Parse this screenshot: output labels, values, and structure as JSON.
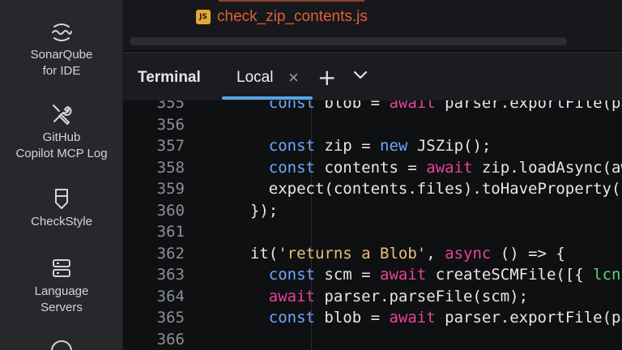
{
  "sidebar": {
    "items": [
      {
        "label": "SonarQube for IDE",
        "line1": "SonarQube",
        "line2": "for IDE",
        "icon": "sonar-wave-icon"
      },
      {
        "label": "GitHub Copilot MCP Log",
        "line1": "GitHub",
        "line2": "Copilot MCP Log",
        "icon": "wrench-screwdriver-icon"
      },
      {
        "label": "CheckStyle",
        "line1": "CheckStyle",
        "line2": "",
        "icon": "checkstyle-shield-icon"
      },
      {
        "label": "Language Servers",
        "line1": "Language",
        "line2": "Servers",
        "icon": "server-stack-icon"
      }
    ]
  },
  "files": {
    "current_file": "check_zip_contents.js",
    "badge": "JS"
  },
  "terminal": {
    "title": "Terminal",
    "tab_label": "Local",
    "close_glyph": "×",
    "add_glyph": "+"
  },
  "code": {
    "lines": [
      {
        "n": "355",
        "text": "    const blob = await parser.exportFile(par"
      },
      {
        "n": "356",
        "text": ""
      },
      {
        "n": "357",
        "text": "    const zip = new JSZip();"
      },
      {
        "n": "358",
        "text": "    const contents = await zip.loadAsync(awa"
      },
      {
        "n": "359",
        "text": "    expect(contents.files).toHaveProperty('C"
      },
      {
        "n": "360",
        "text": "  });"
      },
      {
        "n": "361",
        "text": ""
      },
      {
        "n": "362",
        "text": "  it('returns a Blob', async () => {"
      },
      {
        "n": "363",
        "text": "    const scm = await createSCMFile([{ lcn: "
      },
      {
        "n": "364",
        "text": "    await parser.parseFile(scm);"
      },
      {
        "n": "365",
        "text": "    const blob = await parser.exportFile(par"
      },
      {
        "n": "366",
        "text": ""
      }
    ]
  },
  "colors": {
    "keyword": "#6fa8ff",
    "async_keyword": "#e6459a",
    "string": "#e6c07b",
    "property": "#5fd17a",
    "tab_underline": "#5aa2e6",
    "file_name": "#e0603c"
  }
}
